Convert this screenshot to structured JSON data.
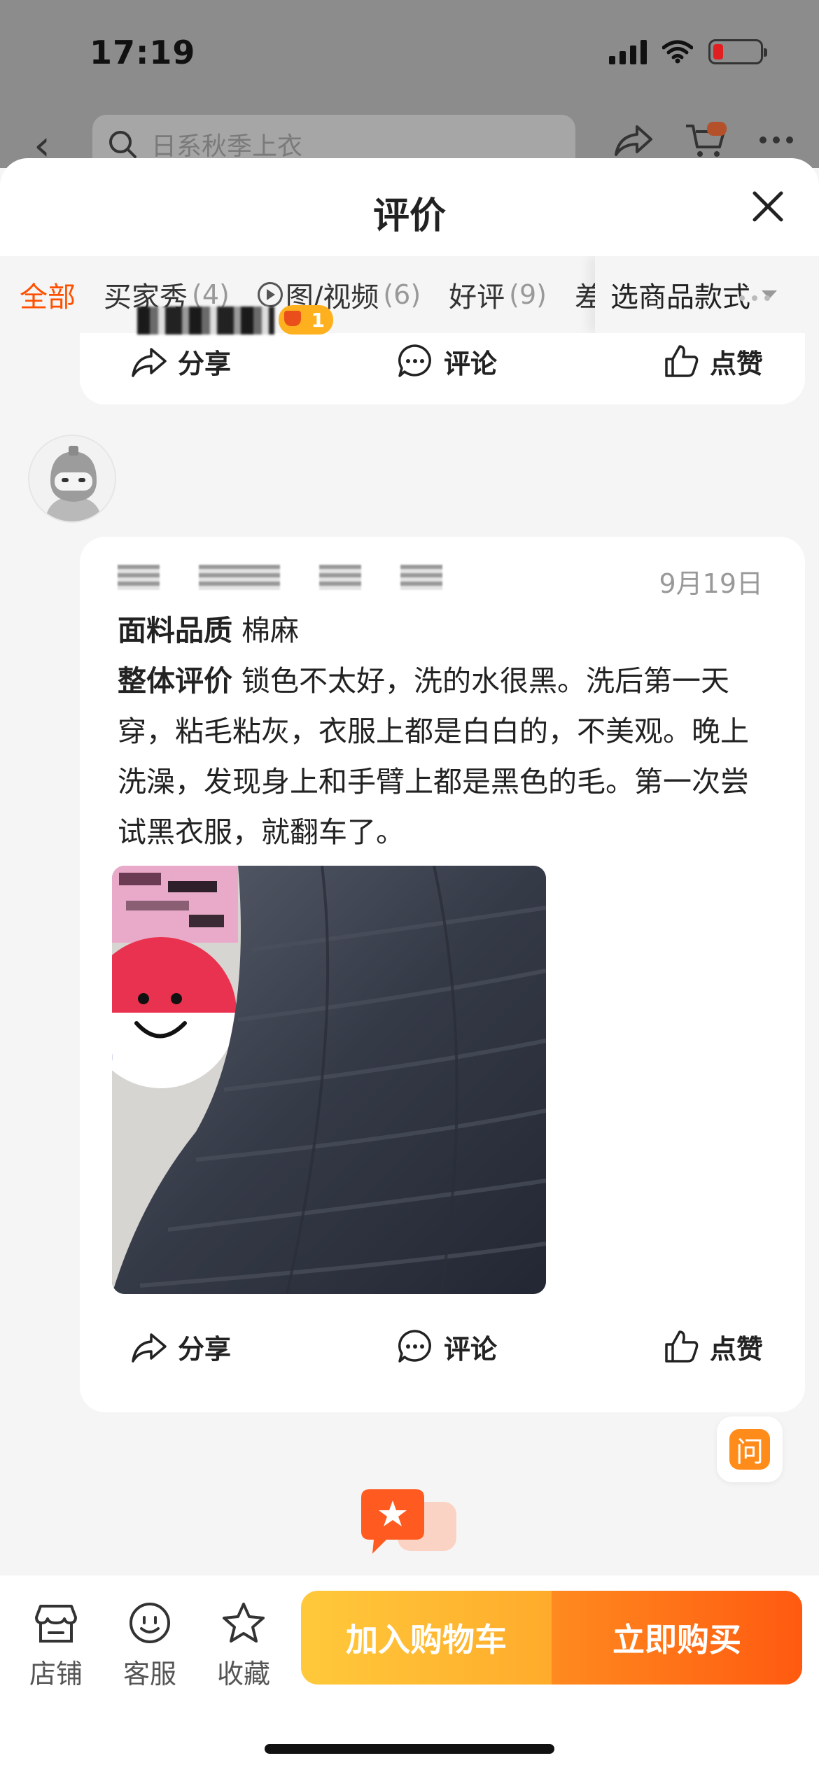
{
  "status_bar": {
    "time": "17:19",
    "battery_color": "#e02020"
  },
  "background_nav": {
    "search_placeholder": "日系秋季上衣"
  },
  "sheet": {
    "title": "评价"
  },
  "tabs": [
    {
      "label": "全部",
      "count": ""
    },
    {
      "label": "买家秀",
      "count": "(4)"
    },
    {
      "label": "图/视频",
      "count": "(6)"
    },
    {
      "label": "好评",
      "count": "(9)"
    },
    {
      "label": "差",
      "count": ""
    }
  ],
  "style_select": {
    "label": "选商品款式"
  },
  "actions": {
    "share": "分享",
    "comment": "评论",
    "like": "点赞"
  },
  "review": {
    "badge_level": "1",
    "date": "9月19日",
    "fabric_label": "面料品质",
    "fabric_value": "棉麻",
    "overall_label": "整体评价",
    "overall_value": "锁色不太好，洗的水很黑。洗后第一天穿，粘毛粘灰，衣服上都是白白的，不美观。晚上洗澡，发现身上和手臂上都是黑色的毛。第一次尝试黑衣服，就翻车了。"
  },
  "ask_button": "问",
  "bottom_bar": {
    "store": "店铺",
    "service": "客服",
    "favorite": "收藏",
    "add_to_cart": "加入购物车",
    "buy_now": "立即购买"
  },
  "colors": {
    "accent": "#ff5000",
    "cart": "#ffb52e",
    "buy": "#ff6a16"
  }
}
